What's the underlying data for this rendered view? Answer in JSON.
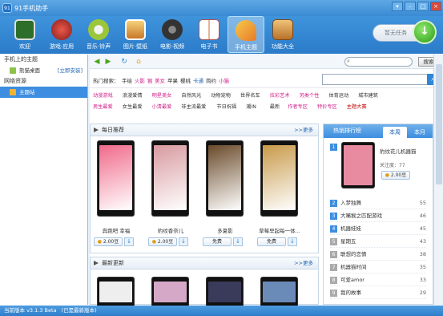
{
  "window": {
    "title": "91手机助手",
    "logo": "91"
  },
  "toolbar": {
    "items": [
      {
        "label": "欢迎",
        "icon": "phone-icon",
        "color": "#2c6e2a"
      },
      {
        "label": "游戏·应用",
        "icon": "games-icon",
        "color": "#c43b2a"
      },
      {
        "label": "音乐·铃声",
        "icon": "music-icon",
        "color": "#9cc63a"
      },
      {
        "label": "图片·壁纸",
        "icon": "picture-icon",
        "color": "#e8b04a"
      },
      {
        "label": "电影·视频",
        "icon": "film-icon",
        "color": "#444444"
      },
      {
        "label": "电子书",
        "icon": "book-icon",
        "color": "#c86a2a"
      },
      {
        "label": "手机主题",
        "icon": "theme-icon",
        "color": "#e8a83a"
      },
      {
        "label": "功能大全",
        "icon": "tools-icon",
        "color": "#d08a2a"
      }
    ],
    "task_label": "暂无任务"
  },
  "sidebar": {
    "section1": "手机上的主题",
    "item1": "熊猫桌面",
    "item1_link": "[立即安装]",
    "section2": "网络资源",
    "item2": "主题站"
  },
  "search": {
    "placeholder": "",
    "button": "搜索"
  },
  "hot": {
    "label": "热门搜索：",
    "words": [
      {
        "t": "手绘",
        "c": "#333"
      },
      {
        "t": "火影",
        "c": "#d0208a"
      },
      {
        "t": "猴",
        "c": "#d0208a"
      },
      {
        "t": "美女",
        "c": "#d0208a"
      },
      {
        "t": "苹果",
        "c": "#333"
      },
      {
        "t": "樱桃",
        "c": "#333"
      },
      {
        "t": "卡通",
        "c": "#1e64b6"
      },
      {
        "t": "简约",
        "c": "#333"
      },
      {
        "t": "小猫",
        "c": "#d0208a"
      }
    ]
  },
  "categories": {
    "row1": [
      {
        "t": "动漫游戏",
        "c": "#d0208a"
      },
      {
        "t": "浪漫爱情",
        "c": "#333"
      },
      {
        "t": "明星美女",
        "c": "#d0208a"
      },
      {
        "t": "自然风光",
        "c": "#333"
      },
      {
        "t": "动物宠物",
        "c": "#333"
      },
      {
        "t": "世界名车",
        "c": "#333"
      },
      {
        "t": "炫彩艺术",
        "c": "#d0208a"
      },
      {
        "t": "另类个性",
        "c": "#d0208a"
      },
      {
        "t": "体育运动",
        "c": "#333"
      },
      {
        "t": "城市建筑",
        "c": "#333"
      }
    ],
    "row2": [
      {
        "t": "男生最爱",
        "c": "#d0208a"
      },
      {
        "t": "女生最爱",
        "c": "#333"
      },
      {
        "t": "小清最爱",
        "c": "#d0208a"
      },
      {
        "t": "非主流最爱",
        "c": "#333"
      },
      {
        "t": "节日祝福",
        "c": "#333"
      },
      {
        "t": "潮IN",
        "c": "#333"
      },
      {
        "t": "最新",
        "c": "#333"
      },
      {
        "t": "作者专区",
        "c": "#d0208a"
      },
      {
        "t": "特价专区",
        "c": "#d0208a"
      },
      {
        "t": "主题大赛",
        "c": "#c00000"
      }
    ]
  },
  "daily": {
    "title": "每日推荐",
    "more": ">>更多",
    "items": [
      {
        "name": "奔跑吧 幸福",
        "price": "2.00豆",
        "free": false,
        "color": "#f06a8a"
      },
      {
        "name": "豹纹香奈儿",
        "price": "2.00豆",
        "free": false,
        "color": "#d89aa0"
      },
      {
        "name": "多夏影",
        "price": "免费",
        "free": true,
        "color": "#6a4a2a"
      },
      {
        "name": "草莓早起每一体...",
        "price": "免费",
        "free": true,
        "color": "#c89a4a"
      }
    ]
  },
  "latest": {
    "title": "最新更新",
    "more": ">>更多"
  },
  "rank": {
    "title": "热销排行榜",
    "tab_week": "本周",
    "tab_month": "本月",
    "top": {
      "name": "豹纹花儿机器猫",
      "follow": "关注度：77",
      "price": "2.00豆"
    },
    "rows": [
      {
        "n": "2",
        "t": "入梦独舞",
        "v": "55"
      },
      {
        "n": "3",
        "t": "大嘴猴之匹配游戏",
        "v": "46"
      },
      {
        "n": "4",
        "t": "机器娃娃",
        "v": "45"
      },
      {
        "n": "5",
        "t": "星期五",
        "v": "43"
      },
      {
        "n": "6",
        "t": "联想的恋情",
        "v": "38"
      },
      {
        "n": "7",
        "t": "机器猫时间",
        "v": "35"
      },
      {
        "n": "8",
        "t": "可爱amor",
        "v": "33"
      },
      {
        "n": "9",
        "t": "我的故事",
        "v": "29"
      }
    ]
  },
  "status": {
    "version": "当前版本  v3.1.3 Beta",
    "latest": "(已是最新版本)"
  }
}
